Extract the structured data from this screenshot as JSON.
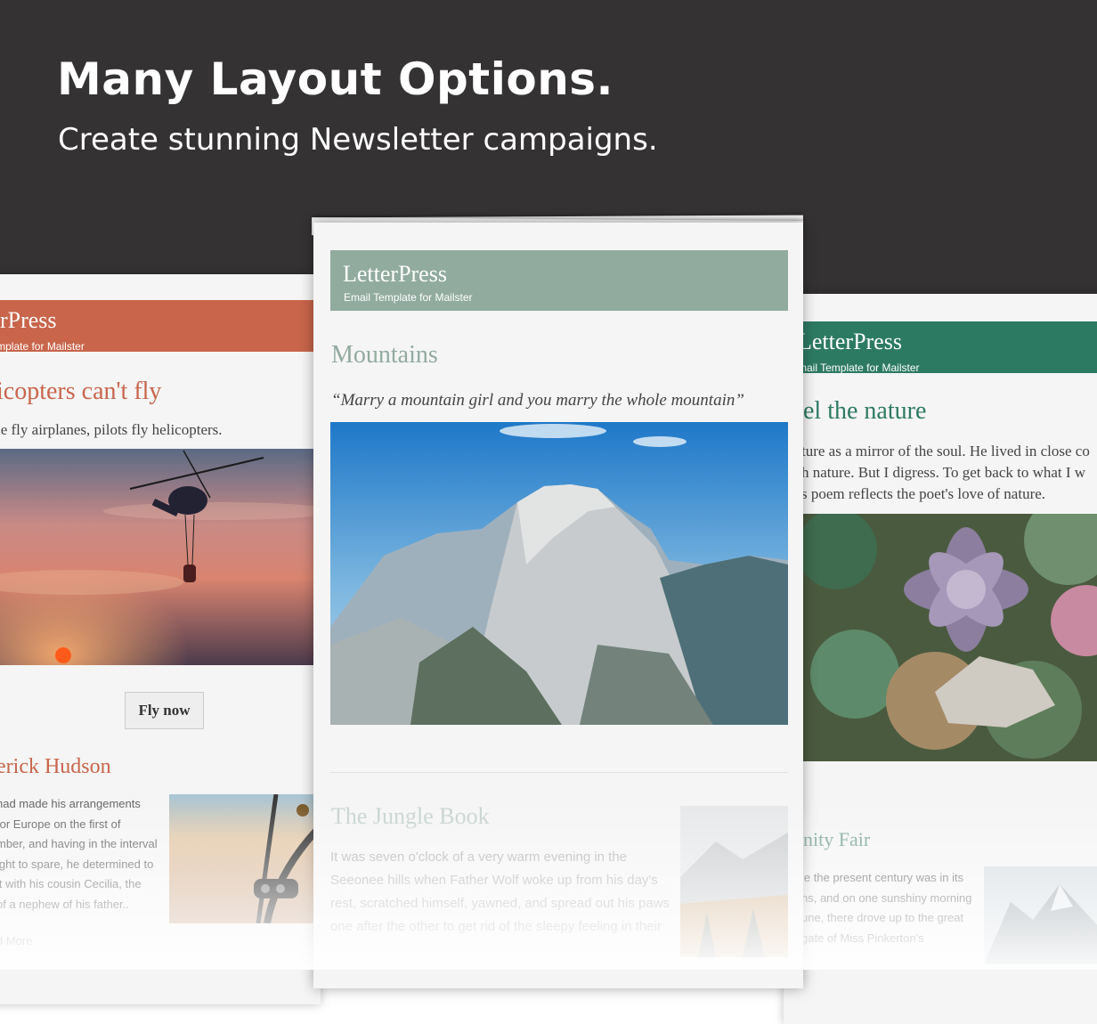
{
  "hero": {
    "title": "Many Layout Options.",
    "subtitle": "Create stunning Newsletter campaigns."
  },
  "colors": {
    "hero_bg": "#343233",
    "left_accent": "#c8654b",
    "center_accent": "#91ab9f",
    "right_accent": "#2d7a63"
  },
  "left_card": {
    "brand": "tterPress",
    "tagline": "il Template for Mailster",
    "headline": "icopters can't fly",
    "lead": "le fly airplanes, pilots fly helicopters.",
    "button": "Fly now",
    "section2_title": "erick Hudson",
    "section2_lines": [
      "had made his arrangements",
      "for Europe on the first of",
      "mber, and having in the interval",
      "ight to spare, he determined to",
      "it with his cousin Cecilia, the",
      "of a nephew of his father.."
    ],
    "read_more": "d More"
  },
  "center_card": {
    "brand": "LetterPress",
    "tagline": "Email Template for Mailster",
    "headline": "Mountains",
    "quote": "“Marry a mountain girl and you marry the whole mountain”",
    "section2_title": "The Jungle Book",
    "section2_lines": [
      "It was seven o'clock of a very warm evening in the",
      "Seeonee hills when Father Wolf woke up from his day's",
      "rest, scratched himself, yawned, and spread out his paws",
      "one after the other to get rid of the sleepy feeling in their"
    ]
  },
  "right_card": {
    "brand": "LetterPress",
    "tagline": "mail Template for Mailster",
    "headline": "el the nature",
    "lead_lines": [
      "ture as a mirror of the soul. He lived in close co",
      "h nature. But I digress. To get back to what I w",
      "s poem reflects the poet's love of nature."
    ],
    "section2_title": "nity Fair",
    "section2_lines": [
      "le the present century was in its",
      "ns, and on one sunshiny morning",
      "une, there drove up to the great",
      "gate of Miss Pinkerton's"
    ]
  }
}
